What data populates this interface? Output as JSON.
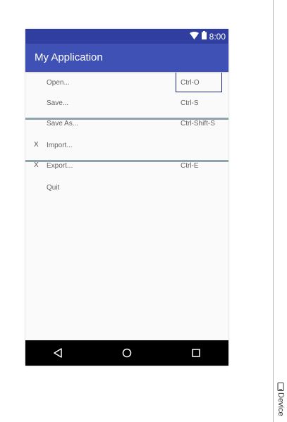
{
  "status_bar": {
    "time": "8:00",
    "color": "#303f9f",
    "icons": [
      "wifi-icon",
      "battery-icon"
    ]
  },
  "toolbar": {
    "title": "My Application",
    "color": "#3f51b5"
  },
  "menu": {
    "groups": [
      {
        "items": [
          {
            "check": "",
            "label": "Open...",
            "shortcut": "Ctrl-O"
          },
          {
            "check": "",
            "label": "Save...",
            "shortcut": "Ctrl-S"
          },
          {
            "check": "",
            "label": "Save As...",
            "shortcut": "Ctrl-Shift-S"
          }
        ]
      },
      {
        "items": [
          {
            "check": "X",
            "label": "Import...",
            "shortcut": ""
          },
          {
            "check": "X",
            "label": "Export...",
            "shortcut": "Ctrl-E"
          }
        ]
      },
      {
        "items": [
          {
            "check": "",
            "label": "Quit",
            "shortcut": ""
          }
        ]
      }
    ]
  },
  "nav_bar": {
    "buttons": [
      "back-icon",
      "home-icon",
      "recents-icon"
    ]
  },
  "side_panel": {
    "tab_label": "Device"
  }
}
